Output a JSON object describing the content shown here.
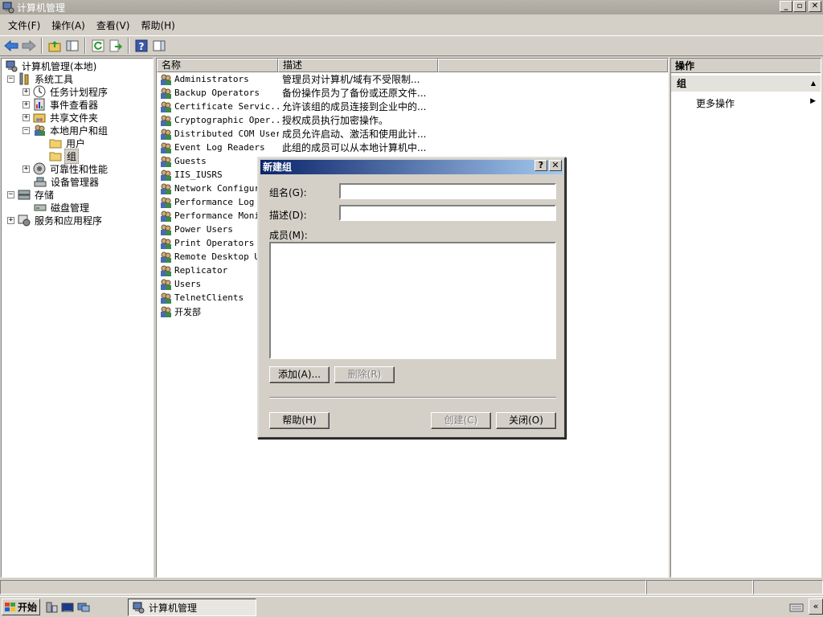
{
  "window": {
    "title": "计算机管理",
    "controls": {
      "minimize": "_",
      "maximize": "▫",
      "close": "✕"
    }
  },
  "menubar": {
    "items": [
      "文件(F)",
      "操作(A)",
      "查看(V)",
      "帮助(H)"
    ]
  },
  "toolbar": {
    "buttons": [
      "back-icon",
      "forward-icon",
      "up-folder-icon",
      "show-hide-tree-icon",
      "refresh-icon",
      "export-list-icon",
      "help-icon",
      "show-hide-action-pane-icon"
    ]
  },
  "tree": {
    "root": "计算机管理(本地)",
    "system_tools": "系统工具",
    "task_scheduler": "任务计划程序",
    "event_viewer": "事件查看器",
    "shared_folders": "共享文件夹",
    "local_users_groups": "本地用户和组",
    "users": "用户",
    "groups": "组",
    "reliability": "可靠性和性能",
    "device_manager": "设备管理器",
    "storage": "存储",
    "disk_management": "磁盘管理",
    "services_apps": "服务和应用程序"
  },
  "list": {
    "columns": {
      "name": "名称",
      "description": "描述"
    },
    "rows": [
      {
        "name": "Administrators",
        "description": "管理员对计算机/域有不受限制..."
      },
      {
        "name": "Backup Operators",
        "description": "备份操作员为了备份或还原文件..."
      },
      {
        "name": "Certificate Servic...",
        "description": "允许该组的成员连接到企业中的..."
      },
      {
        "name": "Cryptographic Oper...",
        "description": "授权成员执行加密操作。"
      },
      {
        "name": "Distributed COM Users",
        "description": "成员允许启动、激活和使用此计..."
      },
      {
        "name": "Event Log Readers",
        "description": "此组的成员可以从本地计算机中..."
      },
      {
        "name": "Guests",
        "description": ""
      },
      {
        "name": "IIS_IUSRS",
        "description": ""
      },
      {
        "name": "Network Configura",
        "description": ""
      },
      {
        "name": "Performance Log U",
        "description": ""
      },
      {
        "name": "Performance Monit",
        "description": ""
      },
      {
        "name": "Power Users",
        "description": ""
      },
      {
        "name": "Print Operators",
        "description": ""
      },
      {
        "name": "Remote Desktop Us",
        "description": ""
      },
      {
        "name": "Replicator",
        "description": ""
      },
      {
        "name": "Users",
        "description": ""
      },
      {
        "name": "TelnetClients",
        "description": ""
      },
      {
        "name": "开发部",
        "description": ""
      }
    ]
  },
  "actions": {
    "header": "操作",
    "section": "组",
    "more": "更多操作"
  },
  "dialog": {
    "title": "新建组",
    "help_glyph": "?",
    "close_glyph": "✕",
    "group_name_label": "组名(G):",
    "group_name_value": "",
    "description_label": "描述(D):",
    "description_value": "",
    "members_label": "成员(M):",
    "add_button": "添加(A)...",
    "remove_button": "删除(R)",
    "help_button": "帮助(H)",
    "create_button": "创建(C)",
    "close_button": "关闭(O)"
  },
  "taskbar": {
    "start": "开始",
    "task": "计算机管理",
    "tray_arrow": "«"
  },
  "colors": {
    "dialog_title_start": "#0a246a",
    "dialog_title_end": "#a6caf0",
    "window_face": "#d4d0c8"
  }
}
